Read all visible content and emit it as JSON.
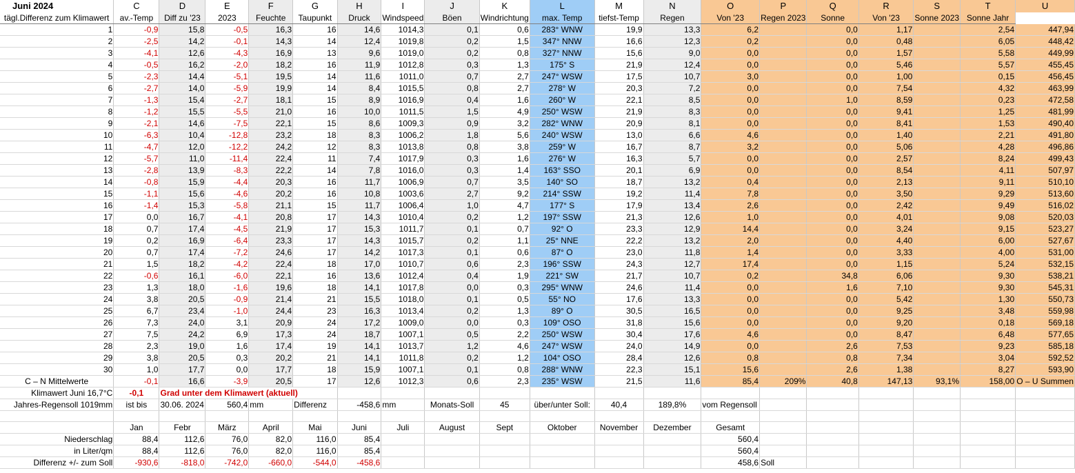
{
  "sheet_title": "Juni 2024",
  "column_letters": [
    "C",
    "D",
    "E",
    "F",
    "G",
    "H",
    "I",
    "J",
    "K",
    "L",
    "M",
    "N",
    "O",
    "P",
    "Q",
    "R",
    "S",
    "T",
    "U"
  ],
  "header_labels": [
    "tägl.Differenz zum Klimawert",
    "av.-Temp",
    "Diff zu '23",
    "2023",
    "Feuchte",
    "Taupunkt",
    "Druck",
    "Windspeed",
    "Böen",
    "Windrichtung",
    "max. Temp",
    "tiefst-Temp",
    "Regen",
    "Von '23",
    "Regen 2023",
    "Sonne",
    "Von '23",
    "Sonne 2023",
    "Sonne Jahr"
  ],
  "rows": [
    [
      "1",
      "-0,9",
      "15,8",
      "-0,5",
      "16,3",
      "16",
      "14,6",
      "1014,3",
      "0,1",
      "0,6",
      "283° WNW",
      "19,9",
      "13,3",
      "6,2",
      "",
      "0,0",
      "1,17",
      "",
      "2,54",
      "447,94"
    ],
    [
      "2",
      "-2,5",
      "14,2",
      "-0,1",
      "14,3",
      "14",
      "12,4",
      "1019,8",
      "0,2",
      "1,5",
      "347° NNW",
      "16,6",
      "12,3",
      "0,2",
      "",
      "0,0",
      "0,48",
      "",
      "6,05",
      "448,42"
    ],
    [
      "3",
      "-4,1",
      "12,6",
      "-4,3",
      "16,9",
      "13",
      "9,6",
      "1019,0",
      "0,2",
      "0,8",
      "327° NNW",
      "15,6",
      "9,0",
      "0,0",
      "",
      "0,0",
      "1,57",
      "",
      "5,58",
      "449,99"
    ],
    [
      "4",
      "-0,5",
      "16,2",
      "-2,0",
      "18,2",
      "16",
      "11,9",
      "1012,8",
      "0,3",
      "1,3",
      "175° S",
      "21,9",
      "12,4",
      "0,0",
      "",
      "0,0",
      "5,46",
      "",
      "5,57",
      "455,45"
    ],
    [
      "5",
      "-2,3",
      "14,4",
      "-5,1",
      "19,5",
      "14",
      "11,6",
      "1011,0",
      "0,7",
      "2,7",
      "247° WSW",
      "17,5",
      "10,7",
      "3,0",
      "",
      "0,0",
      "1,00",
      "",
      "0,15",
      "456,45"
    ],
    [
      "6",
      "-2,7",
      "14,0",
      "-5,9",
      "19,9",
      "14",
      "8,4",
      "1015,5",
      "0,8",
      "2,7",
      "278° W",
      "20,3",
      "7,2",
      "0,0",
      "",
      "0,0",
      "7,54",
      "",
      "4,32",
      "463,99"
    ],
    [
      "7",
      "-1,3",
      "15,4",
      "-2,7",
      "18,1",
      "15",
      "8,9",
      "1016,9",
      "0,4",
      "1,6",
      "260° W",
      "22,1",
      "8,5",
      "0,0",
      "",
      "1,0",
      "8,59",
      "",
      "0,23",
      "472,58"
    ],
    [
      "8",
      "-1,2",
      "15,5",
      "-5,5",
      "21,0",
      "16",
      "10,0",
      "1011,5",
      "1,5",
      "4,9",
      "250° WSW",
      "21,9",
      "8,3",
      "0,0",
      "",
      "0,0",
      "9,41",
      "",
      "1,25",
      "481,99"
    ],
    [
      "9",
      "-2,1",
      "14,6",
      "-7,5",
      "22,1",
      "15",
      "8,6",
      "1009,3",
      "0,9",
      "3,2",
      "282° WNW",
      "20,9",
      "8,1",
      "0,0",
      "",
      "0,0",
      "8,41",
      "",
      "1,53",
      "490,40"
    ],
    [
      "10",
      "-6,3",
      "10,4",
      "-12,8",
      "23,2",
      "18",
      "8,3",
      "1006,2",
      "1,8",
      "5,6",
      "240° WSW",
      "13,0",
      "6,6",
      "4,6",
      "",
      "0,0",
      "1,40",
      "",
      "2,21",
      "491,80"
    ],
    [
      "11",
      "-4,7",
      "12,0",
      "-12,2",
      "24,2",
      "12",
      "8,3",
      "1013,8",
      "0,8",
      "3,8",
      "259° W",
      "16,7",
      "8,7",
      "3,2",
      "",
      "0,0",
      "5,06",
      "",
      "4,28",
      "496,86"
    ],
    [
      "12",
      "-5,7",
      "11,0",
      "-11,4",
      "22,4",
      "11",
      "7,4",
      "1017,9",
      "0,3",
      "1,6",
      "276° W",
      "16,3",
      "5,7",
      "0,0",
      "",
      "0,0",
      "2,57",
      "",
      "8,24",
      "499,43"
    ],
    [
      "13",
      "-2,8",
      "13,9",
      "-8,3",
      "22,2",
      "14",
      "7,8",
      "1016,0",
      "0,3",
      "1,4",
      "163° SSO",
      "20,1",
      "6,9",
      "0,0",
      "",
      "0,0",
      "8,54",
      "",
      "4,11",
      "507,97"
    ],
    [
      "14",
      "-0,8",
      "15,9",
      "-4,4",
      "20,3",
      "16",
      "11,7",
      "1006,9",
      "0,7",
      "3,5",
      "140° SO",
      "18,7",
      "13,2",
      "0,4",
      "",
      "0,0",
      "2,13",
      "",
      "9,11",
      "510,10"
    ],
    [
      "15",
      "-1,1",
      "15,6",
      "-4,6",
      "20,2",
      "16",
      "10,8",
      "1003,6",
      "2,7",
      "9,2",
      "214° SSW",
      "19,2",
      "11,4",
      "7,8",
      "",
      "0,0",
      "3,50",
      "",
      "9,29",
      "513,60"
    ],
    [
      "16",
      "-1,4",
      "15,3",
      "-5,8",
      "21,1",
      "15",
      "11,7",
      "1006,4",
      "1,0",
      "4,7",
      "177° S",
      "17,9",
      "13,4",
      "2,6",
      "",
      "0,0",
      "2,42",
      "",
      "9,49",
      "516,02"
    ],
    [
      "17",
      "0,0",
      "16,7",
      "-4,1",
      "20,8",
      "17",
      "14,3",
      "1010,4",
      "0,2",
      "1,2",
      "197° SSW",
      "21,3",
      "12,6",
      "1,0",
      "",
      "0,0",
      "4,01",
      "",
      "9,08",
      "520,03"
    ],
    [
      "18",
      "0,7",
      "17,4",
      "-4,5",
      "21,9",
      "17",
      "15,3",
      "1011,7",
      "0,1",
      "0,7",
      "92° O",
      "23,3",
      "12,9",
      "14,4",
      "",
      "0,0",
      "3,24",
      "",
      "9,15",
      "523,27"
    ],
    [
      "19",
      "0,2",
      "16,9",
      "-6,4",
      "23,3",
      "17",
      "14,3",
      "1015,7",
      "0,2",
      "1,1",
      "25° NNE",
      "22,2",
      "13,2",
      "2,0",
      "",
      "0,0",
      "4,40",
      "",
      "6,00",
      "527,67"
    ],
    [
      "20",
      "0,7",
      "17,4",
      "-7,2",
      "24,6",
      "17",
      "14,2",
      "1017,3",
      "0,1",
      "0,6",
      "87° O",
      "23,0",
      "11,8",
      "1,4",
      "",
      "0,0",
      "3,33",
      "",
      "4,00",
      "531,00"
    ],
    [
      "21",
      "1,5",
      "18,2",
      "-4,2",
      "22,4",
      "18",
      "17,0",
      "1010,7",
      "0,6",
      "2,3",
      "196° SSW",
      "24,3",
      "12,7",
      "17,4",
      "",
      "0,0",
      "1,15",
      "",
      "5,24",
      "532,15"
    ],
    [
      "22",
      "-0,6",
      "16,1",
      "-6,0",
      "22,1",
      "16",
      "13,6",
      "1012,4",
      "0,4",
      "1,9",
      "221° SW",
      "21,7",
      "10,7",
      "0,2",
      "",
      "34,8",
      "6,06",
      "",
      "9,30",
      "538,21"
    ],
    [
      "23",
      "1,3",
      "18,0",
      "-1,6",
      "19,6",
      "18",
      "14,1",
      "1017,8",
      "0,0",
      "0,3",
      "295° WNW",
      "24,6",
      "11,4",
      "0,0",
      "",
      "1,6",
      "7,10",
      "",
      "9,30",
      "545,31"
    ],
    [
      "24",
      "3,8",
      "20,5",
      "-0,9",
      "21,4",
      "21",
      "15,5",
      "1018,0",
      "0,1",
      "0,5",
      "55° NO",
      "17,6",
      "13,3",
      "0,0",
      "",
      "0,0",
      "5,42",
      "",
      "1,30",
      "550,73"
    ],
    [
      "25",
      "6,7",
      "23,4",
      "-1,0",
      "24,4",
      "23",
      "16,3",
      "1013,4",
      "0,2",
      "1,3",
      "89° O",
      "30,5",
      "16,5",
      "0,0",
      "",
      "0,0",
      "9,25",
      "",
      "3,48",
      "559,98"
    ],
    [
      "26",
      "7,3",
      "24,0",
      "3,1",
      "20,9",
      "24",
      "17,2",
      "1009,0",
      "0,0",
      "0,3",
      "109° OSO",
      "31,8",
      "15,6",
      "0,0",
      "",
      "0,0",
      "9,20",
      "",
      "0,18",
      "569,18"
    ],
    [
      "27",
      "7,5",
      "24,2",
      "6,9",
      "17,3",
      "24",
      "18,7",
      "1007,1",
      "0,5",
      "2,2",
      "250° WSW",
      "30,4",
      "17,6",
      "4,6",
      "",
      "0,0",
      "8,47",
      "",
      "6,48",
      "577,65"
    ],
    [
      "28",
      "2,3",
      "19,0",
      "1,6",
      "17,4",
      "19",
      "14,1",
      "1013,7",
      "1,2",
      "4,6",
      "247° WSW",
      "24,0",
      "14,9",
      "0,0",
      "",
      "2,6",
      "7,53",
      "",
      "9,23",
      "585,18"
    ],
    [
      "29",
      "3,8",
      "20,5",
      "0,3",
      "20,2",
      "21",
      "14,1",
      "1011,8",
      "0,2",
      "1,2",
      "104° OSO",
      "28,4",
      "12,6",
      "0,8",
      "",
      "0,8",
      "7,34",
      "",
      "3,04",
      "592,52"
    ],
    [
      "30",
      "1,0",
      "17,7",
      "0,0",
      "17,7",
      "18",
      "15,9",
      "1007,1",
      "0,1",
      "0,8",
      "288° WNW",
      "22,3",
      "15,1",
      "15,6",
      "",
      "2,6",
      "1,38",
      "",
      "8,27",
      "593,90"
    ]
  ],
  "mean_row": {
    "label": "C – N Mittelwerte",
    "values": [
      "-0,1",
      "16,6",
      "-3,9",
      "20,5",
      "17",
      "12,6",
      "1012,3",
      "0,6",
      "2,3",
      "235° WSW",
      "21,5",
      "11,6",
      "85,4",
      "209%",
      "40,8",
      "147,13",
      "93,1%",
      "158,00",
      "O – U Summen"
    ]
  },
  "summary": {
    "klimawert_label": "Klimawert Juni 16,7°C",
    "klimawert_value": "-0,1",
    "klimawert_text": "Grad unter dem Klimawert (aktuell)",
    "regensoll_label": "Jahres-Regensoll 1019mm",
    "ist_bis_label": "ist bis",
    "ist_bis_date": "30.06. 2024",
    "ist_bis_value": "560,4",
    "mm1": "mm",
    "differenz_label": "Differenz",
    "differenz_value": "-458,6",
    "mm2": "mm",
    "monats_soll_label": "Monats-Soll",
    "monats_soll_value": "45",
    "ueber_unter_label": "über/unter Soll:",
    "ueber_unter_value": "40,4",
    "percent_value": "189,8%",
    "vom_regensoll": "vom Regensoll"
  },
  "months": [
    "Jan",
    "Febr",
    "März",
    "April",
    "Mai",
    "Juni",
    "Juli",
    "August",
    "Sept",
    "Oktober",
    "November",
    "Dezember",
    "Gesamt"
  ],
  "niederschlag": {
    "label": "Niederschlag",
    "values": [
      "88,4",
      "112,6",
      "76,0",
      "82,0",
      "116,0",
      "85,4",
      "",
      "",
      "",
      "",
      "",
      "",
      "560,4"
    ]
  },
  "liter": {
    "label": "in Liter/qm",
    "values": [
      "88,4",
      "112,6",
      "76,0",
      "82,0",
      "116,0",
      "85,4",
      "",
      "",
      "",
      "",
      "",
      "",
      "560,4"
    ]
  },
  "differenz_soll": {
    "label": "Differenz  +/- zum Soll",
    "values": [
      "-930,6",
      "-818,0",
      "-742,0",
      "-660,0",
      "-544,0",
      "-458,6",
      "",
      "",
      "",
      "",
      "",
      "",
      "458,6"
    ],
    "suffix": "Soll"
  },
  "colors": {
    "gray": "#ececec",
    "blue": "#9fcdf6",
    "orange": "#f9c894",
    "negative": "#d00000"
  }
}
